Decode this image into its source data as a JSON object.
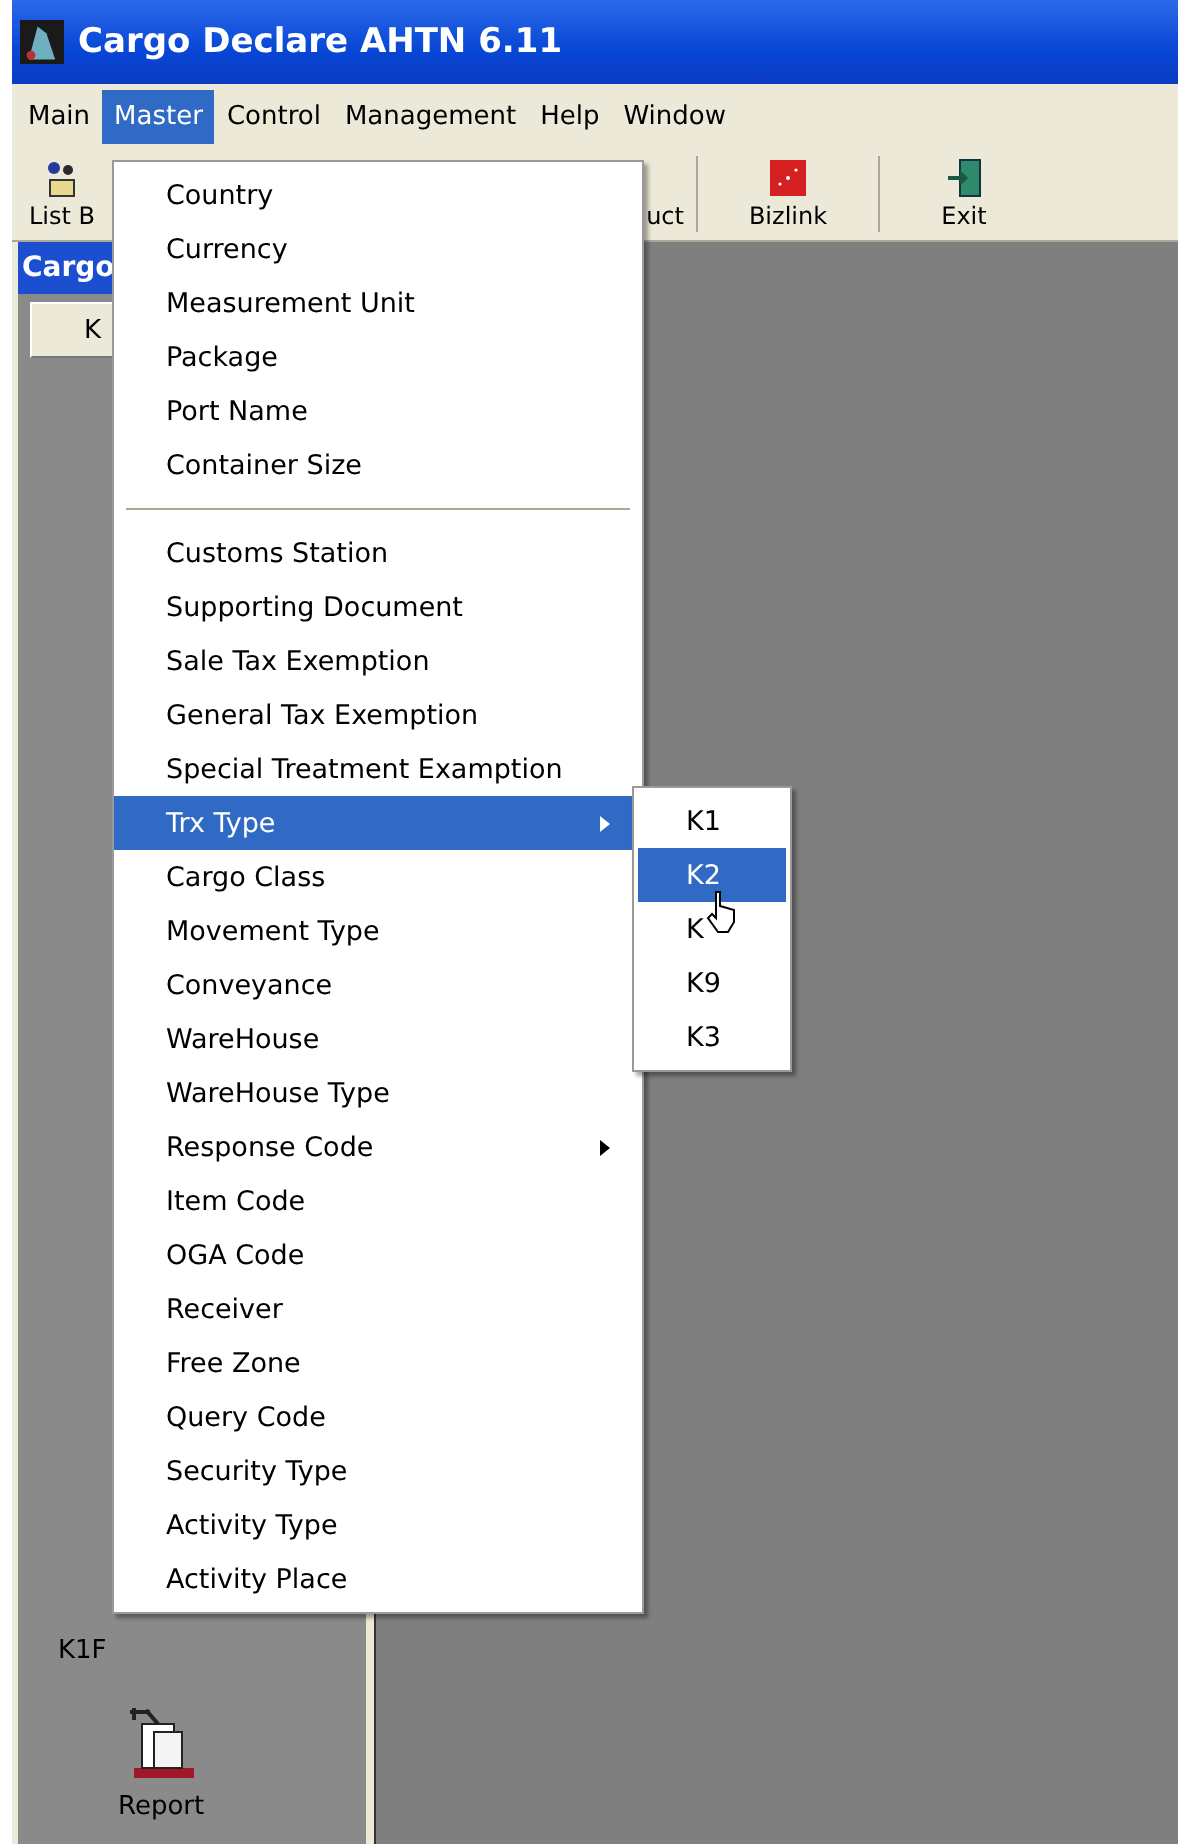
{
  "window": {
    "title": "Cargo Declare AHTN 6.11"
  },
  "menubar": [
    {
      "label": "Main",
      "selected": false
    },
    {
      "label": "Master",
      "selected": true
    },
    {
      "label": "Control",
      "selected": false
    },
    {
      "label": "Management",
      "selected": false
    },
    {
      "label": "Help",
      "selected": false
    },
    {
      "label": "Window",
      "selected": false
    }
  ],
  "toolbar": [
    {
      "label": "List B"
    },
    {
      "label": "uct"
    },
    {
      "label": "Bizlink"
    },
    {
      "label": "Exit"
    }
  ],
  "panel": {
    "header": "Cargo",
    "tab": "K",
    "label": "K1F",
    "report": "Report"
  },
  "menu": [
    {
      "kind": "item",
      "label": "Country",
      "selected": false,
      "submenu": false
    },
    {
      "kind": "item",
      "label": "Currency",
      "selected": false,
      "submenu": false
    },
    {
      "kind": "item",
      "label": "Measurement Unit",
      "selected": false,
      "submenu": false
    },
    {
      "kind": "item",
      "label": "Package",
      "selected": false,
      "submenu": false
    },
    {
      "kind": "item",
      "label": "Port Name",
      "selected": false,
      "submenu": false
    },
    {
      "kind": "item",
      "label": "Container Size",
      "selected": false,
      "submenu": false
    },
    {
      "kind": "separator"
    },
    {
      "kind": "item",
      "label": "Customs Station",
      "selected": false,
      "submenu": false
    },
    {
      "kind": "item",
      "label": "Supporting Document",
      "selected": false,
      "submenu": false
    },
    {
      "kind": "item",
      "label": "Sale Tax Exemption",
      "selected": false,
      "submenu": false
    },
    {
      "kind": "item",
      "label": "General Tax Exemption",
      "selected": false,
      "submenu": false
    },
    {
      "kind": "item",
      "label": "Special Treatment Examption",
      "selected": false,
      "submenu": false
    },
    {
      "kind": "item",
      "label": "Trx Type",
      "selected": true,
      "submenu": true
    },
    {
      "kind": "item",
      "label": "Cargo Class",
      "selected": false,
      "submenu": false
    },
    {
      "kind": "item",
      "label": "Movement Type",
      "selected": false,
      "submenu": false
    },
    {
      "kind": "item",
      "label": "Conveyance",
      "selected": false,
      "submenu": false
    },
    {
      "kind": "item",
      "label": "WareHouse",
      "selected": false,
      "submenu": false
    },
    {
      "kind": "item",
      "label": "WareHouse Type",
      "selected": false,
      "submenu": false
    },
    {
      "kind": "item",
      "label": "Response Code",
      "selected": false,
      "submenu": true
    },
    {
      "kind": "item",
      "label": "Item Code",
      "selected": false,
      "submenu": false
    },
    {
      "kind": "item",
      "label": "OGA Code",
      "selected": false,
      "submenu": false
    },
    {
      "kind": "item",
      "label": "Receiver",
      "selected": false,
      "submenu": false
    },
    {
      "kind": "item",
      "label": "Free Zone",
      "selected": false,
      "submenu": false
    },
    {
      "kind": "item",
      "label": "Query Code",
      "selected": false,
      "submenu": false
    },
    {
      "kind": "item",
      "label": "Security Type",
      "selected": false,
      "submenu": false
    },
    {
      "kind": "item",
      "label": "Activity Type",
      "selected": false,
      "submenu": false
    },
    {
      "kind": "item",
      "label": "Activity Place",
      "selected": false,
      "submenu": false
    }
  ],
  "submenu": [
    {
      "label": "K1",
      "selected": false
    },
    {
      "label": "K2",
      "selected": true
    },
    {
      "label": "K",
      "selected": false
    },
    {
      "label": "K9",
      "selected": false
    },
    {
      "label": "K3",
      "selected": false
    }
  ]
}
